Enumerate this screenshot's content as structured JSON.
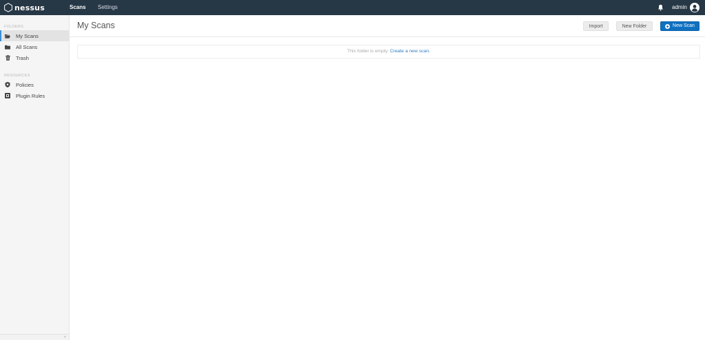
{
  "app": {
    "logo_text": "nessus"
  },
  "topnav": {
    "tabs": [
      {
        "label": "Scans",
        "active": true
      },
      {
        "label": "Settings",
        "active": false
      }
    ],
    "user_name": "admin"
  },
  "sidebar": {
    "folders_label": "FOLDERS",
    "folders": [
      {
        "label": "My Scans",
        "icon": "folder-open-icon",
        "active": true
      },
      {
        "label": "All Scans",
        "icon": "folder-icon",
        "active": false
      },
      {
        "label": "Trash",
        "icon": "trash-icon",
        "active": false
      }
    ],
    "resources_label": "RESOURCES",
    "resources": [
      {
        "label": "Policies",
        "icon": "policy-icon"
      },
      {
        "label": "Plugin Rules",
        "icon": "plugin-rules-icon"
      }
    ],
    "collapse_glyph": "«"
  },
  "main": {
    "title": "My Scans",
    "buttons": {
      "import": "Import",
      "new_folder": "New Folder",
      "new_scan": "New Scan"
    },
    "empty_text": "This folder is empty.",
    "empty_link": "Create a new scan."
  },
  "colors": {
    "topbar": "#263746",
    "primary_button": "#0f70c0",
    "active_accent": "#3c8ed7",
    "link": "#2f7dc0",
    "sidebar_bg": "#f5f5f5"
  }
}
